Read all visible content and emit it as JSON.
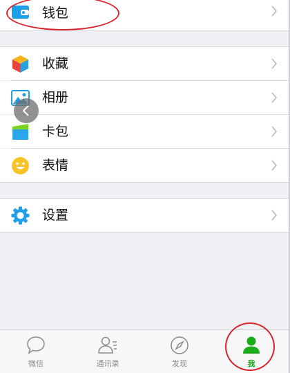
{
  "menu": {
    "wallet": {
      "label": "钱包",
      "icon": "wallet-icon"
    },
    "favorites": {
      "label": "收藏",
      "icon": "favorites-cube-icon"
    },
    "album": {
      "label": "相册",
      "icon": "album-picture-icon"
    },
    "cards": {
      "label": "卡包",
      "icon": "card-pack-icon"
    },
    "stickers": {
      "label": "表情",
      "icon": "smiley-icon"
    },
    "settings": {
      "label": "设置",
      "icon": "gear-icon"
    }
  },
  "tabbar": {
    "tabs": [
      {
        "label": "微信",
        "icon": "chat-bubble-icon",
        "active": false
      },
      {
        "label": "通讯录",
        "icon": "contacts-icon",
        "active": false
      },
      {
        "label": "发现",
        "icon": "compass-icon",
        "active": false
      },
      {
        "label": "我",
        "icon": "person-icon",
        "active": true
      }
    ]
  },
  "colors": {
    "background": "#efeff4",
    "accent_green": "#1aad19",
    "annotation_red": "#d9232a",
    "icon_blue": "#1da0e8",
    "smiley_yellow": "#f7c325"
  }
}
